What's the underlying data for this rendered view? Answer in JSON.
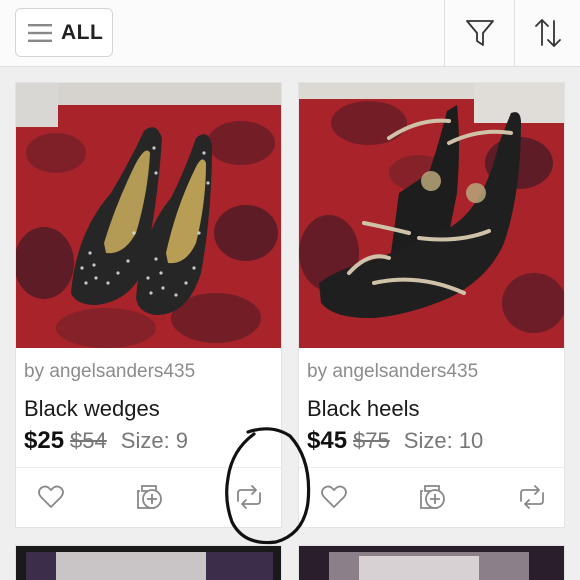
{
  "header": {
    "all_label": "ALL",
    "menu_icon": "hamburger-icon",
    "filter_icon": "filter-icon",
    "sort_icon": "sort-icon"
  },
  "listings": [
    {
      "seller": "by angelsanders435",
      "title": "Black wedges",
      "price": "$25",
      "original_price": "$54",
      "size": "Size: 9",
      "photo": "studded black high heel pumps on red floral fabric"
    },
    {
      "seller": "by angelsanders435",
      "title": "Black heels",
      "price": "$45",
      "original_price": "$75",
      "size": "Size: 10",
      "photo": "black strappy heeled sandals with gold straps on red floral fabric"
    }
  ],
  "actions": [
    "like-icon",
    "bundle-add-icon",
    "share-icon"
  ],
  "colors": {
    "background": "#efefef",
    "card": "#ffffff",
    "muted_text": "#8c8c8c",
    "icon": "#888888",
    "annotation_circle": "#111111"
  }
}
